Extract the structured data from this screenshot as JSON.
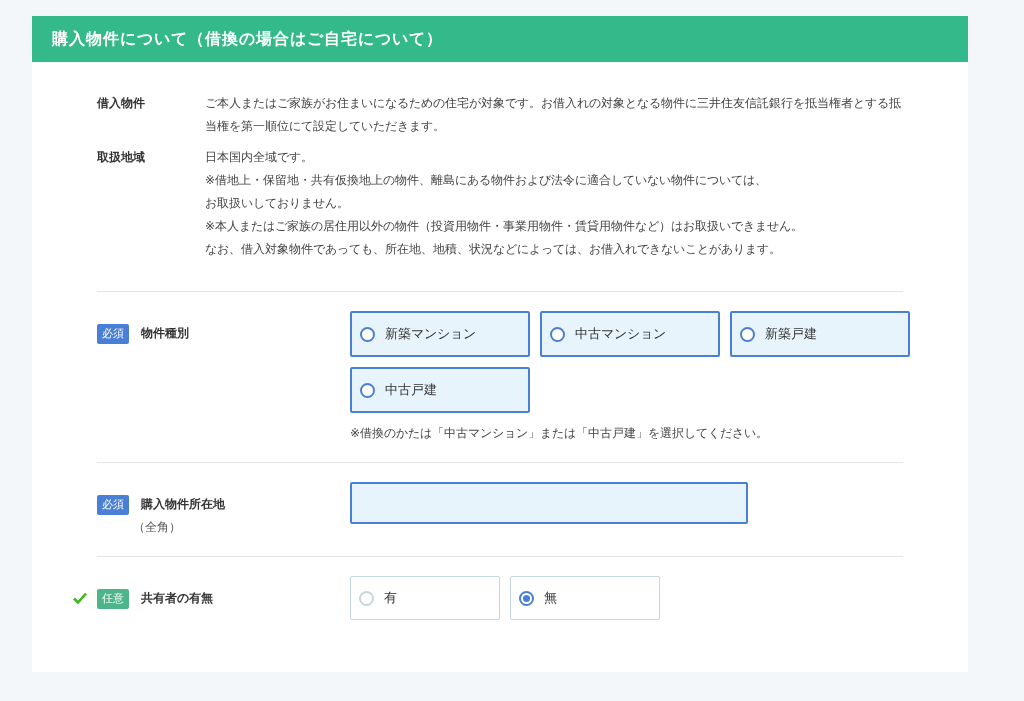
{
  "section": {
    "title": "購入物件について（借換の場合はご自宅について）"
  },
  "descriptions": [
    {
      "label": "借入物件",
      "lines": [
        "ご本人またはご家族がお住まいになるための住宅が対象です。お借入れの対象となる物件に三井住友信託銀行を抵当権者とする抵当権を第一順位にて設定していただきます。"
      ]
    },
    {
      "label": "取扱地域",
      "lines": [
        "日本国内全域です。",
        "※借地上・保留地・共有仮換地上の物件、離島にある物件および法令に適合していない物件については、",
        "お取扱いしておりません。",
        "※本人またはご家族の居住用以外の物件（投資用物件・事業用物件・賃貸用物件など）はお取扱いできません。",
        "なお、借入対象物件であっても、所在地、地積、状況などによっては、お借入れできないことがあります。"
      ]
    }
  ],
  "fields": [
    {
      "kind": "radio",
      "badge": {
        "label": "必須",
        "kind": "required"
      },
      "label": "物件種別",
      "completed": false,
      "options": [
        {
          "label": "新築マンション",
          "selected": false
        },
        {
          "label": "中古マンション",
          "selected": false
        },
        {
          "label": "新築戸建",
          "selected": false
        },
        {
          "label": "中古戸建",
          "selected": false
        }
      ],
      "note": "※借換のかたは「中古マンション」または「中古戸建」を選択してください。"
    },
    {
      "kind": "text",
      "badge": {
        "label": "必須",
        "kind": "required"
      },
      "label": "購入物件所在地",
      "sublabel": "（全角）",
      "completed": false
    },
    {
      "kind": "radio",
      "badge": {
        "label": "任意",
        "kind": "optional"
      },
      "label": "共有者の有無",
      "completed": true,
      "small": true,
      "options": [
        {
          "label": "有",
          "selected": false
        },
        {
          "label": "無",
          "selected": true
        }
      ]
    }
  ]
}
